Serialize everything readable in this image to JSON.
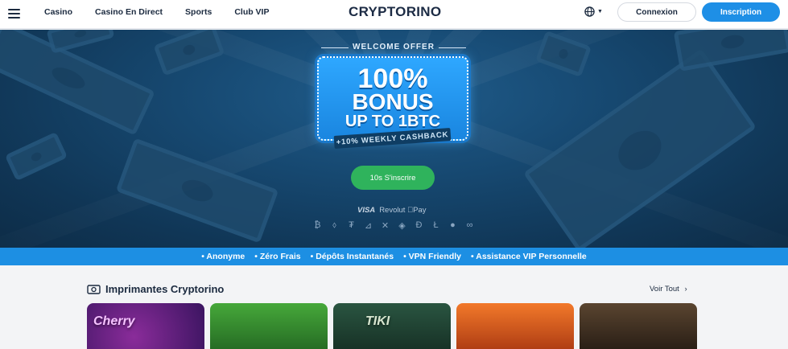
{
  "header": {
    "nav": [
      "Casino",
      "Casino En Direct",
      "Sports",
      "Club VIP"
    ],
    "logo": "CRYPTORINO",
    "login_label": "Connexion",
    "signup_label": "Inscription",
    "icons": [
      "hamburger-menu-icon",
      "globe-icon",
      "chevron-down-icon"
    ]
  },
  "hero": {
    "welcome": "WELCOME OFFER",
    "line1": "100%",
    "line2": "BONUS",
    "line3": "UP TO 1BTC",
    "ribbon": "+10% WEEKLY CASHBACK",
    "cta_label": "10s S'inscrire",
    "payments": {
      "visa": "VISA",
      "revolut": "Revolut",
      "apple_pay": "Pay"
    },
    "crypto_icons": [
      "₿",
      "⬨",
      "₮",
      "⊿",
      "✕",
      "◈",
      "Đ",
      "Ł",
      "●",
      "∞"
    ]
  },
  "features": [
    "• Anonyme",
    "• Zéro Frais",
    "• Dépôts Instantanés",
    "• VPN Friendly",
    "• Assistance VIP Personnelle"
  ],
  "section": {
    "title": "Imprimantes Cryptorino",
    "see_all": "Voir Tout",
    "tiles": [
      {
        "caption": "Cherry",
        "bg": "#3a1460"
      },
      {
        "caption": "",
        "bg": "#2f8a2f"
      },
      {
        "caption": "TIKI",
        "bg": "#1c3b2b"
      },
      {
        "caption": "",
        "bg": "#c1431a"
      },
      {
        "caption": "",
        "bg": "#2a2018"
      }
    ]
  },
  "colors": {
    "accent": "#1e8fe6",
    "cta": "#2fb35c",
    "hero_bg": "#174a73"
  }
}
